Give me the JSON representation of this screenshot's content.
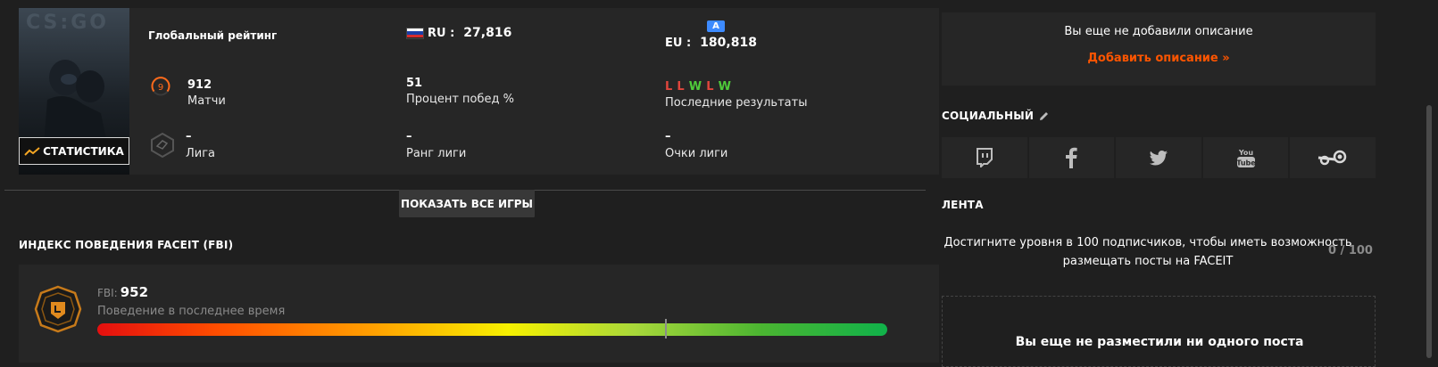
{
  "game_card": {
    "cover_logo": "CS:GO",
    "stats_button_label": "СТАТИСТИКА",
    "global_rating_label": "Глобальный рейтинг",
    "region_ru": {
      "prefix": "RU :",
      "value": "27,816"
    },
    "region_eu": {
      "badge": "A",
      "prefix": "EU :",
      "value": "180,818"
    },
    "skill_level": "9",
    "matches": {
      "value": "912",
      "label": "Матчи"
    },
    "win_rate": {
      "value": "51",
      "label": "Процент побед %"
    },
    "recent_results": {
      "items": [
        "L",
        "L",
        "W",
        "L",
        "W"
      ],
      "label": "Последние результаты"
    },
    "league": {
      "value": "–",
      "label": "Лига"
    },
    "league_rank": {
      "value": "–",
      "label": "Ранг лиги"
    },
    "league_points": {
      "value": "–",
      "label": "Очки лиги"
    }
  },
  "show_all_games_button": "ПОКАЗАТЬ ВСЕ ИГРЫ",
  "fbi": {
    "section_title": "ИНДЕКС ПОВЕДЕНИЯ FACEIT (FBI)",
    "prefix": "FBI:",
    "value": "952",
    "subtitle": "Поведение в последнее время",
    "bar_position_fraction": 0.72
  },
  "description": {
    "empty_text": "Вы еще не добавили описание",
    "add_link": "Добавить описание »"
  },
  "social": {
    "title": "СОЦИАЛЬНЫЙ",
    "networks": [
      "twitch-icon",
      "facebook-icon",
      "twitter-icon",
      "youtube-icon",
      "steam-icon"
    ]
  },
  "feed": {
    "title": "ЛЕНТА",
    "requirement_text": "Достигните уровня в 100 подписчиков, чтобы иметь возможность размещать посты на FACEIT",
    "count": "0 / 100",
    "no_posts_text": "Вы еще не разместили ни одного поста"
  },
  "colors": {
    "accent_orange": "#ff5500",
    "loss_red": "#e0463d",
    "win_green": "#4fcb3a",
    "eu_badge_blue": "#3d8bff"
  }
}
